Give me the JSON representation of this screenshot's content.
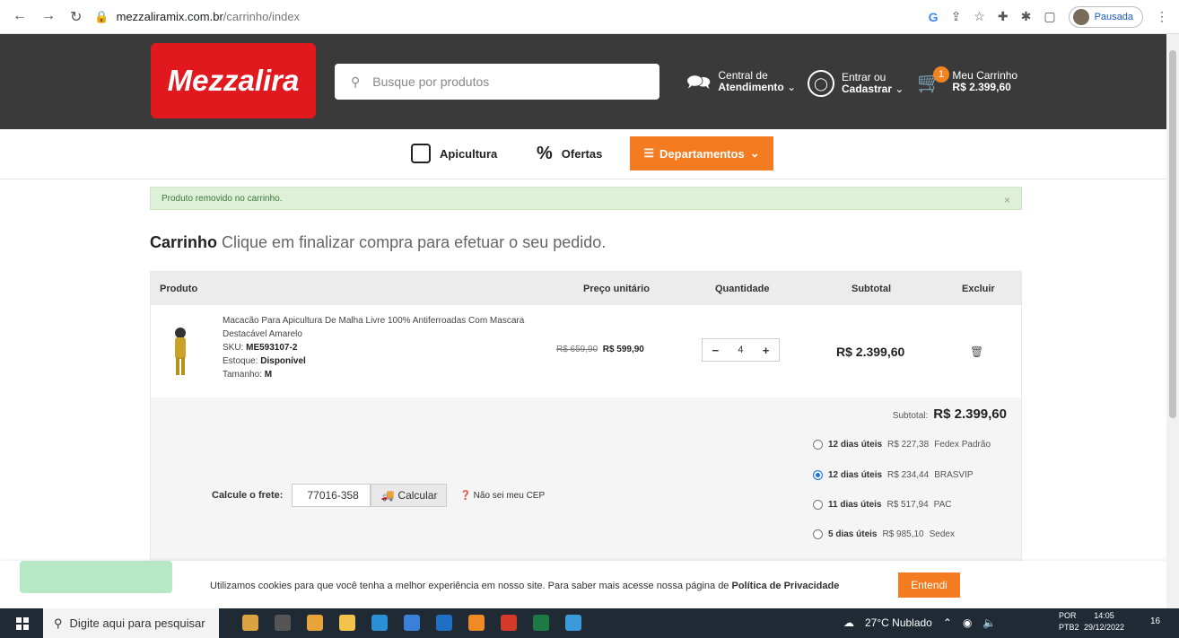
{
  "browser": {
    "url_domain": "mezzaliramix.com.br",
    "url_path": "/carrinho/index",
    "profile_label": "Pausada"
  },
  "header": {
    "logo_text": "Mezzalira",
    "search_placeholder": "Busque por produtos",
    "support_line1": "Central de",
    "support_line2": "Atendimento",
    "account_line1": "Entrar ou",
    "account_line2": "Cadastrar",
    "cart_line1": "Meu Carrinho",
    "cart_total": "R$ 2.399,60",
    "cart_count": "1"
  },
  "subnav": {
    "apicultura": "Apicultura",
    "ofertas": "Ofertas",
    "departamentos": "Departamentos"
  },
  "alert": {
    "message": "Produto removido no carrinho.",
    "close": "×"
  },
  "page": {
    "title_bold": "Carrinho",
    "title_rest": "Clique em finalizar compra para efetuar o seu pedido."
  },
  "table": {
    "headers": [
      "Produto",
      "Preço unitário",
      "Quantidade",
      "Subtotal",
      "Excluir"
    ],
    "item": {
      "name_line1": "Macacão Para Apicultura De Malha Livre 100% Antiferroadas Com Mascara",
      "name_line2": "Destacável Amarelo",
      "sku_label": "SKU:",
      "sku": "ME593107-2",
      "stock_label": "Estoque:",
      "stock": "Disponível",
      "size_label": "Tamanho:",
      "size": "M",
      "old_price": "R$ 659,90",
      "price": "R$ 599,90",
      "quantity": "4",
      "subtotal": "R$ 2.399,60"
    },
    "subtotal_label": "Subtotal:",
    "subtotal_value": "R$ 2.399,60"
  },
  "shipping": {
    "label": "Calcule o frete:",
    "cep": "77016-358",
    "calc_button": "Calcular",
    "help": "Não sei meu CEP",
    "options": [
      {
        "days": "12 dias úteis",
        "price": "R$ 227,38",
        "carrier": "Fedex Padrão",
        "selected": false
      },
      {
        "days": "12 dias úteis",
        "price": "R$ 234,44",
        "carrier": "BRASVIP",
        "selected": true
      },
      {
        "days": "11 dias úteis",
        "price": "R$ 517,94",
        "carrier": "PAC",
        "selected": false
      },
      {
        "days": "5 dias úteis",
        "price": "R$ 985,10",
        "carrier": "Sedex",
        "selected": false
      }
    ]
  },
  "cookie": {
    "text": "Utilizamos cookies para que você tenha a melhor experiência em nosso site. Para saber mais acesse nossa página de",
    "link": "Política de Privacidade",
    "button": "Entendi"
  },
  "taskbar": {
    "search": "Digite aqui para pesquisar",
    "weather": "27°C Nublado",
    "lang1": "POR",
    "lang2": "PTB2",
    "time": "14:05",
    "date": "29/12/2022",
    "notif_count": "16"
  }
}
